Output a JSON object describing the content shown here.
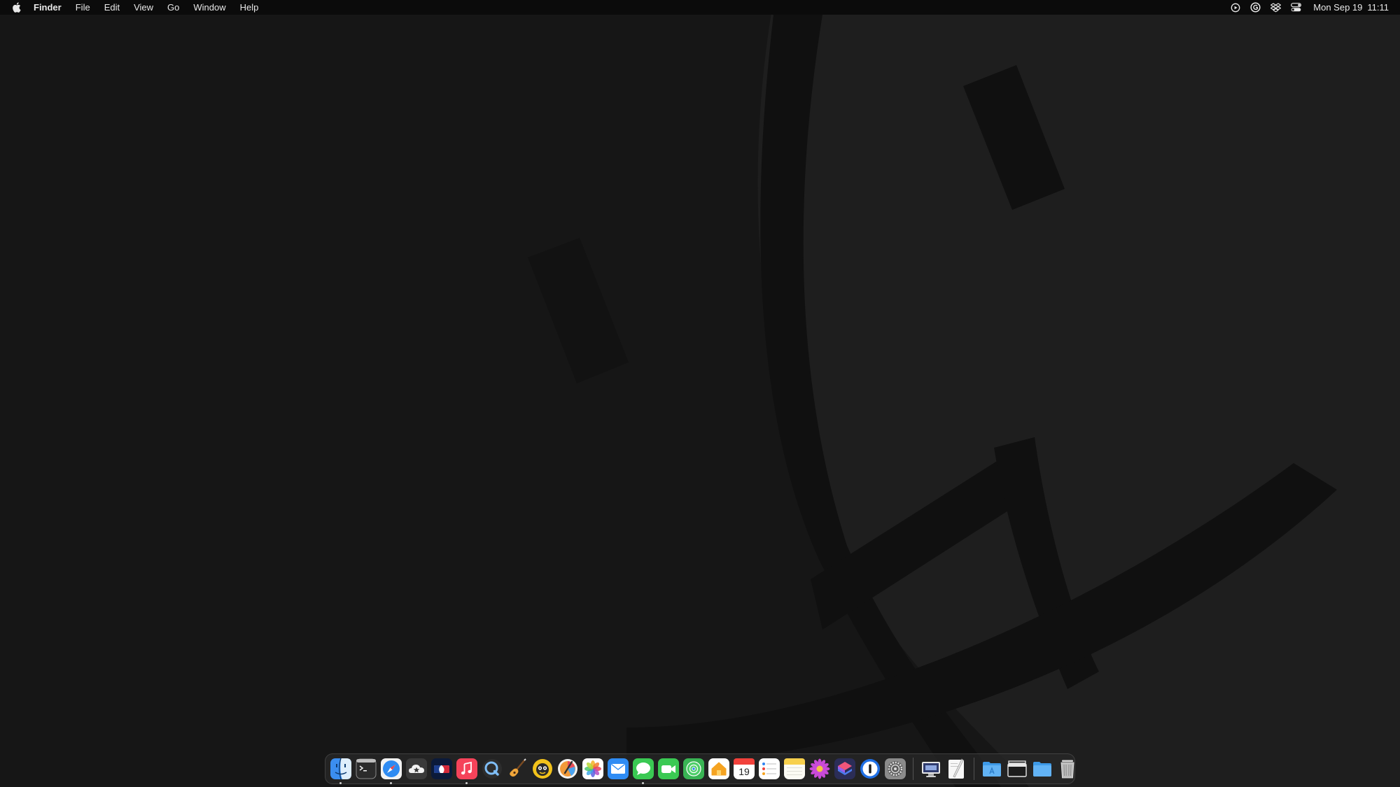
{
  "menubar": {
    "apple_icon": "apple-logo-icon",
    "app_name": "Finder",
    "menus": [
      {
        "label": "File"
      },
      {
        "label": "Edit"
      },
      {
        "label": "View"
      },
      {
        "label": "Go"
      },
      {
        "label": "Window"
      },
      {
        "label": "Help"
      }
    ],
    "status_icons": [
      "play-circle-icon",
      "grammarly-icon",
      "dropbox-icon",
      "control-center-icon"
    ],
    "clock": {
      "date": "Mon Sep 19",
      "time": "11:11"
    }
  },
  "dock": {
    "apps": [
      {
        "name": "Finder",
        "icon": "finder-icon",
        "running": true
      },
      {
        "name": "Terminal",
        "icon": "terminal-icon",
        "running": false
      },
      {
        "name": "Safari",
        "icon": "safari-icon",
        "running": true
      },
      {
        "name": "Cloud App",
        "icon": "cloud-app-icon",
        "running": false
      },
      {
        "name": "MLB",
        "icon": "mlb-icon",
        "running": false
      },
      {
        "name": "Music",
        "icon": "music-icon",
        "running": true
      },
      {
        "name": "QuickTime",
        "icon": "quicktime-icon",
        "running": false
      },
      {
        "name": "GarageBand",
        "icon": "guitar-icon",
        "running": false
      },
      {
        "name": "Podcast App",
        "icon": "mascot-app-icon",
        "running": false
      },
      {
        "name": "Pixelmator",
        "icon": "pixelmator-icon",
        "running": false
      },
      {
        "name": "Photos",
        "icon": "photos-icon",
        "running": false
      },
      {
        "name": "Mail",
        "icon": "mail-icon",
        "running": false
      },
      {
        "name": "Messages",
        "icon": "messages-icon",
        "running": true
      },
      {
        "name": "FaceTime",
        "icon": "facetime-icon",
        "running": false
      },
      {
        "name": "Find My",
        "icon": "find-my-icon",
        "running": false
      },
      {
        "name": "Home",
        "icon": "home-icon",
        "running": false
      },
      {
        "name": "Calendar",
        "icon": "calendar-icon",
        "running": false,
        "day": "19"
      },
      {
        "name": "Reminders",
        "icon": "reminders-icon",
        "running": false
      },
      {
        "name": "Notes",
        "icon": "notes-icon",
        "running": false
      },
      {
        "name": "Flower App",
        "icon": "flower-icon",
        "running": false
      },
      {
        "name": "Shortcuts",
        "icon": "shortcuts-icon",
        "running": false
      },
      {
        "name": "1Password",
        "icon": "1password-icon",
        "running": false
      },
      {
        "name": "System Settings",
        "icon": "system-settings-icon",
        "running": false
      }
    ],
    "utilities": [
      {
        "name": "Screen Sharing",
        "icon": "screen-sharing-icon"
      },
      {
        "name": "TextEdit",
        "icon": "textedit-icon"
      }
    ],
    "stacks": [
      {
        "name": "Applications",
        "icon": "applications-folder-icon"
      },
      {
        "name": "Windows",
        "icon": "windows-stack-icon"
      },
      {
        "name": "Downloads",
        "icon": "downloads-folder-icon"
      },
      {
        "name": "Trash",
        "icon": "trash-icon"
      }
    ]
  }
}
